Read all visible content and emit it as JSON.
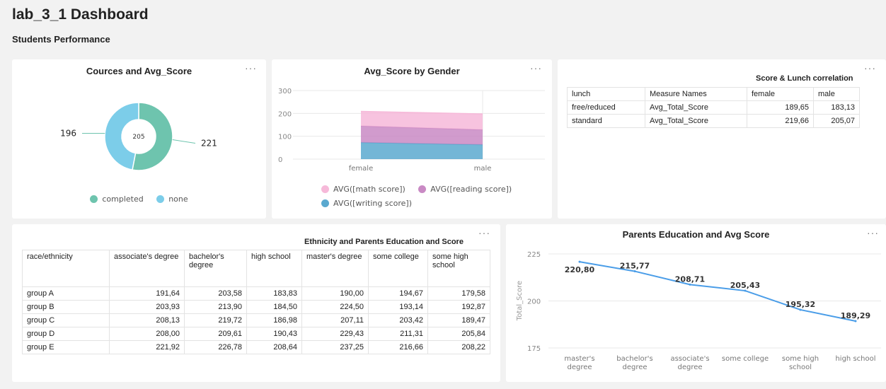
{
  "dashboard": {
    "title": "lab_3_1 Dashboard",
    "subtitle": "Students Performance"
  },
  "menu_label": "···",
  "donut": {
    "title": "Cources and Avg_Score",
    "center_label": "205",
    "legend": [
      "completed",
      "none"
    ],
    "chart_data": {
      "type": "pie",
      "categories": [
        "completed",
        "none"
      ],
      "values": [
        221,
        196
      ],
      "colors": [
        "#6ec4ae",
        "#7ccde9"
      ],
      "labels": [
        "221",
        "196"
      ]
    }
  },
  "gender": {
    "title": "Avg_Score by Gender",
    "legend": [
      "AVG([math score])",
      "AVG([reading score])",
      "AVG([writing score])"
    ],
    "chart_data": {
      "type": "area",
      "categories": [
        "female",
        "male"
      ],
      "series": [
        {
          "name": "AVG([writing score])",
          "values": [
            72.5,
            63.3
          ],
          "color": "#5aa9cf"
        },
        {
          "name": "AVG([reading score])",
          "values": [
            72.6,
            65.5
          ],
          "color": "#c98ac4"
        },
        {
          "name": "AVG([math score])",
          "values": [
            63.6,
            68.7
          ],
          "color": "#f6b9d9"
        }
      ],
      "stacked": true,
      "ylim": [
        0,
        300
      ],
      "yticks": [
        "0",
        "100",
        "200",
        "300"
      ]
    }
  },
  "lunch": {
    "title": "Score & Lunch correlation",
    "headers": [
      "lunch",
      "Measure Names",
      "female",
      "male"
    ],
    "rows": [
      [
        "free/reduced",
        "Avg_Total_Score",
        "189,65",
        "183,13"
      ],
      [
        "standard",
        "Avg_Total_Score",
        "219,66",
        "205,07"
      ]
    ]
  },
  "ethnicity": {
    "title": "Ethnicity and Parents Education and Score",
    "headers": [
      "race/ethnicity",
      "associate's degree",
      "bachelor's degree",
      "high school",
      "master's degree",
      "some college",
      "some high school"
    ],
    "rows": [
      [
        "group A",
        "191,64",
        "203,58",
        "183,83",
        "190,00",
        "194,67",
        "179,58"
      ],
      [
        "group B",
        "203,93",
        "213,90",
        "184,50",
        "224,50",
        "193,14",
        "192,87"
      ],
      [
        "group C",
        "208,13",
        "219,72",
        "186,98",
        "207,11",
        "203,42",
        "189,47"
      ],
      [
        "group D",
        "208,00",
        "209,61",
        "190,43",
        "229,43",
        "211,31",
        "205,84"
      ],
      [
        "group E",
        "221,92",
        "226,78",
        "208,64",
        "237,25",
        "216,66",
        "208,22"
      ]
    ]
  },
  "education": {
    "title": "Parents Education and Avg Score",
    "chart_data": {
      "type": "line",
      "categories": [
        "master's degree",
        "bachelor's degree",
        "associate's degree",
        "some college",
        "some high school",
        "high school"
      ],
      "values": [
        220.8,
        215.77,
        208.71,
        205.43,
        195.32,
        189.29
      ],
      "labels": [
        "220,80",
        "215,77",
        "208,71",
        "205,43",
        "195,32",
        "189,29"
      ],
      "ylabel": "Total_Score",
      "ylim": [
        175,
        225
      ],
      "yticks": [
        "175",
        "200",
        "225"
      ],
      "color": "#4a9de8"
    }
  }
}
